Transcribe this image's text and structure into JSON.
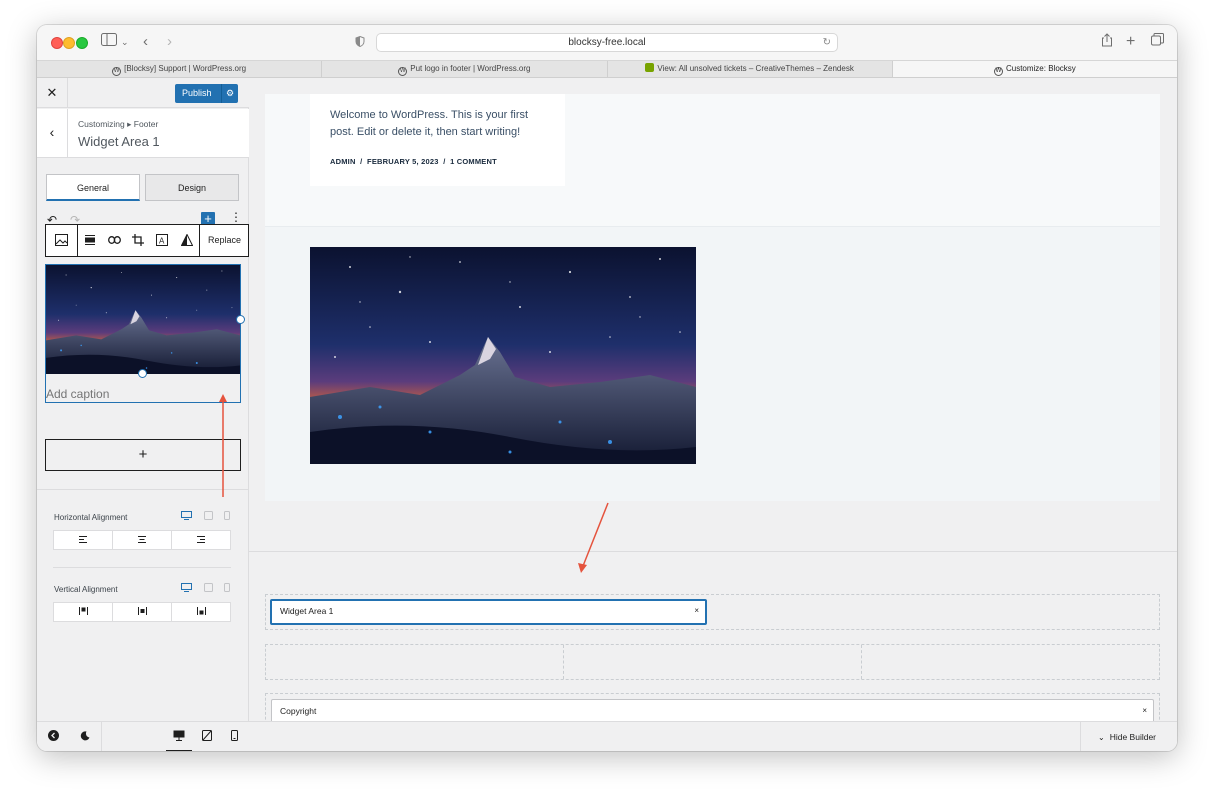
{
  "browser": {
    "url": "blocksy-free.local",
    "tabs": [
      {
        "label": "[Blocksy] Support | WordPress.org",
        "favicon": "wordpress-icon",
        "active": false
      },
      {
        "label": "Put logo in footer | WordPress.org",
        "favicon": "wordpress-icon",
        "active": false
      },
      {
        "label": "View: All unsolved tickets – CreativeThemes – Zendesk",
        "favicon": "zendesk-icon",
        "active": false
      },
      {
        "label": "Customize: Blocksy",
        "favicon": "wordpress-icon",
        "active": true
      }
    ]
  },
  "sidebar": {
    "publish_label": "Publish",
    "breadcrumb": "Customizing ▸ Footer",
    "title": "Widget Area 1",
    "tabs": {
      "general": "General",
      "design": "Design"
    },
    "toolbar": {
      "replace_label": "Replace"
    },
    "image_block": {
      "caption_placeholder": "Add caption"
    },
    "add_block_label": "+",
    "horizontal_alignment": {
      "label": "Horizontal Alignment"
    },
    "vertical_alignment": {
      "label": "Vertical Alignment"
    }
  },
  "preview": {
    "post_excerpt": "Welcome to WordPress. This is your first post. Edit or delete it, then start writing!",
    "meta": {
      "author": "ADMIN",
      "date": "FEBRUARY 5, 2023",
      "comments": "1 COMMENT",
      "separator": "/"
    }
  },
  "builder": {
    "widget_area_label": "Widget Area 1",
    "copyright_label": "Copyright",
    "remove_symbol": "×",
    "hide_builder_label": "Hide Builder"
  },
  "colors": {
    "accent": "#2271b1",
    "annotation_arrow": "#e5533d"
  }
}
